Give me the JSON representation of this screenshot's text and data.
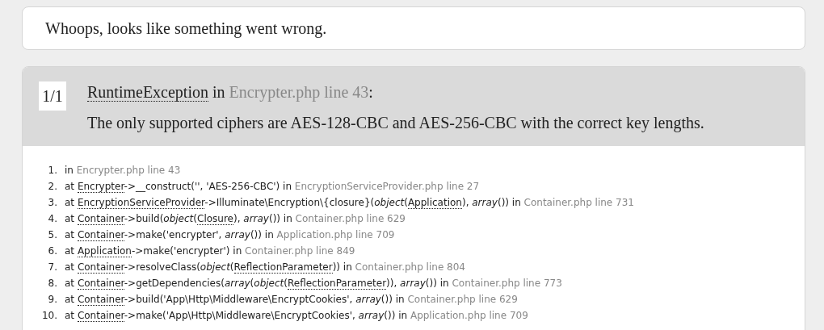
{
  "notice": "Whoops, looks like something went wrong.",
  "exception": {
    "counter": "1/1",
    "class_name": "RuntimeException",
    "in_word": "in",
    "location": "Encrypter.php line 43",
    "colon": ":",
    "message": "The only supported ciphers are AES-128-CBC and AES-256-CBC with the correct key lengths."
  },
  "trace": [
    {
      "number": "1.",
      "parts": [
        {
          "kind": "text",
          "text": "in "
        },
        {
          "kind": "file",
          "text": "Encrypter.php line 43"
        }
      ]
    },
    {
      "number": "2.",
      "parts": [
        {
          "kind": "text",
          "text": "at "
        },
        {
          "kind": "class",
          "text": "Encrypter"
        },
        {
          "kind": "text",
          "text": "->__construct('', 'AES-256-CBC') in "
        },
        {
          "kind": "file",
          "text": "EncryptionServiceProvider.php line 27"
        }
      ]
    },
    {
      "number": "3.",
      "parts": [
        {
          "kind": "text",
          "text": "at "
        },
        {
          "kind": "class",
          "text": "EncryptionServiceProvider"
        },
        {
          "kind": "text",
          "text": "->Illuminate\\Encryption\\{closure}("
        },
        {
          "kind": "italic",
          "text": "object"
        },
        {
          "kind": "text",
          "text": "("
        },
        {
          "kind": "class",
          "text": "Application"
        },
        {
          "kind": "text",
          "text": "), "
        },
        {
          "kind": "italic",
          "text": "array"
        },
        {
          "kind": "text",
          "text": "()) in "
        },
        {
          "kind": "file",
          "text": "Container.php line 731"
        }
      ]
    },
    {
      "number": "4.",
      "parts": [
        {
          "kind": "text",
          "text": "at "
        },
        {
          "kind": "class",
          "text": "Container"
        },
        {
          "kind": "text",
          "text": "->build("
        },
        {
          "kind": "italic",
          "text": "object"
        },
        {
          "kind": "text",
          "text": "("
        },
        {
          "kind": "class",
          "text": "Closure"
        },
        {
          "kind": "text",
          "text": "), "
        },
        {
          "kind": "italic",
          "text": "array"
        },
        {
          "kind": "text",
          "text": "()) in "
        },
        {
          "kind": "file",
          "text": "Container.php line 629"
        }
      ]
    },
    {
      "number": "5.",
      "parts": [
        {
          "kind": "text",
          "text": "at "
        },
        {
          "kind": "class",
          "text": "Container"
        },
        {
          "kind": "text",
          "text": "->make('encrypter', "
        },
        {
          "kind": "italic",
          "text": "array"
        },
        {
          "kind": "text",
          "text": "()) in "
        },
        {
          "kind": "file",
          "text": "Application.php line 709"
        }
      ]
    },
    {
      "number": "6.",
      "parts": [
        {
          "kind": "text",
          "text": "at "
        },
        {
          "kind": "class",
          "text": "Application"
        },
        {
          "kind": "text",
          "text": "->make('encrypter') in "
        },
        {
          "kind": "file",
          "text": "Container.php line 849"
        }
      ]
    },
    {
      "number": "7.",
      "parts": [
        {
          "kind": "text",
          "text": "at "
        },
        {
          "kind": "class",
          "text": "Container"
        },
        {
          "kind": "text",
          "text": "->resolveClass("
        },
        {
          "kind": "italic",
          "text": "object"
        },
        {
          "kind": "text",
          "text": "("
        },
        {
          "kind": "class",
          "text": "ReflectionParameter"
        },
        {
          "kind": "text",
          "text": ")) in "
        },
        {
          "kind": "file",
          "text": "Container.php line 804"
        }
      ]
    },
    {
      "number": "8.",
      "parts": [
        {
          "kind": "text",
          "text": "at "
        },
        {
          "kind": "class",
          "text": "Container"
        },
        {
          "kind": "text",
          "text": "->getDependencies("
        },
        {
          "kind": "italic",
          "text": "array"
        },
        {
          "kind": "text",
          "text": "("
        },
        {
          "kind": "italic",
          "text": "object"
        },
        {
          "kind": "text",
          "text": "("
        },
        {
          "kind": "class",
          "text": "ReflectionParameter"
        },
        {
          "kind": "text",
          "text": ")), "
        },
        {
          "kind": "italic",
          "text": "array"
        },
        {
          "kind": "text",
          "text": "()) in "
        },
        {
          "kind": "file",
          "text": "Container.php line 773"
        }
      ]
    },
    {
      "number": "9.",
      "parts": [
        {
          "kind": "text",
          "text": "at "
        },
        {
          "kind": "class",
          "text": "Container"
        },
        {
          "kind": "text",
          "text": "->build('App\\Http\\Middleware\\EncryptCookies', "
        },
        {
          "kind": "italic",
          "text": "array"
        },
        {
          "kind": "text",
          "text": "()) in "
        },
        {
          "kind": "file",
          "text": "Container.php line 629"
        }
      ]
    },
    {
      "number": "10.",
      "parts": [
        {
          "kind": "text",
          "text": "at "
        },
        {
          "kind": "class",
          "text": "Container"
        },
        {
          "kind": "text",
          "text": "->make('App\\Http\\Middleware\\EncryptCookies', "
        },
        {
          "kind": "italic",
          "text": "array"
        },
        {
          "kind": "text",
          "text": "()) in "
        },
        {
          "kind": "file",
          "text": "Application.php line 709"
        }
      ]
    }
  ]
}
